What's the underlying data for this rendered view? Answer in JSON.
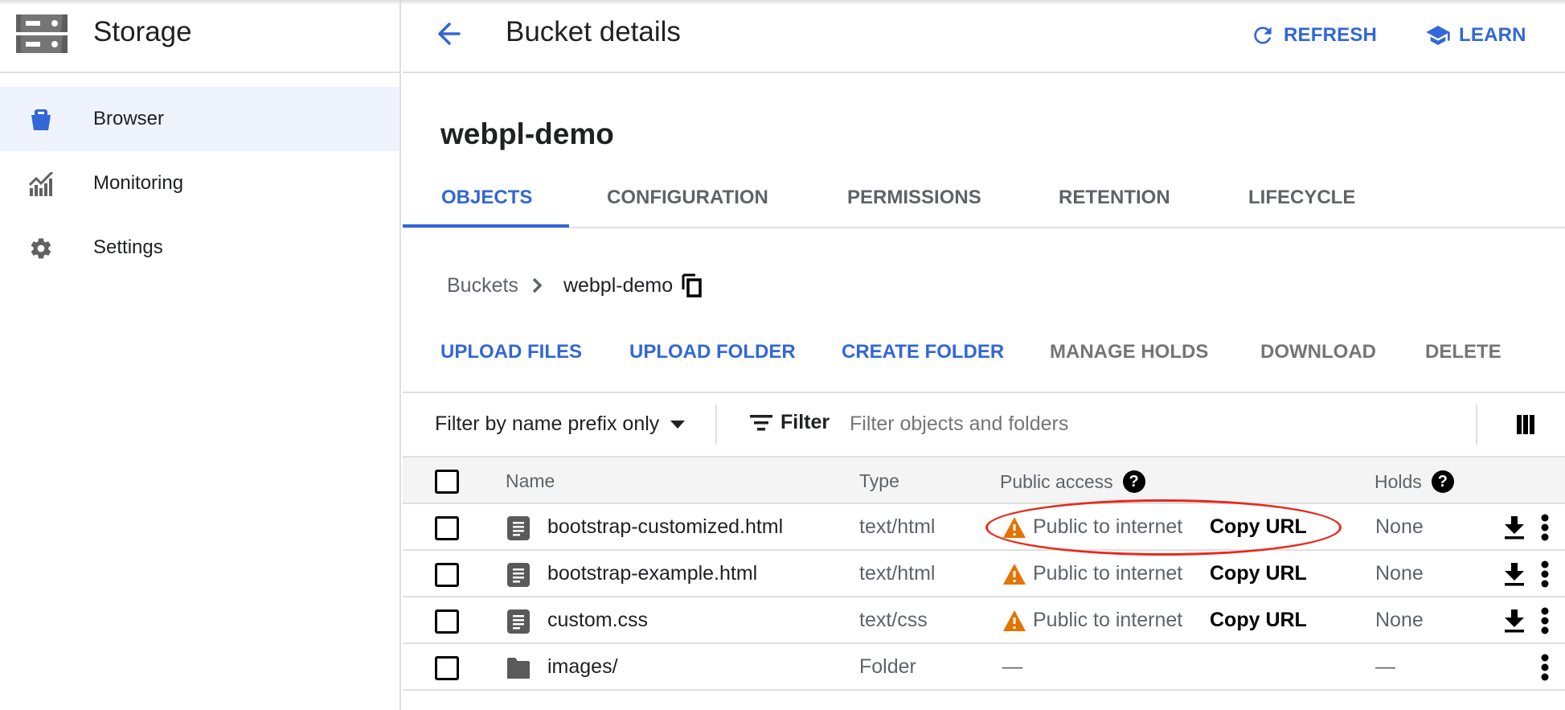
{
  "app": {
    "title": "Storage",
    "logo_icon": "storage-icon"
  },
  "sidebar": {
    "items": [
      {
        "label": "Browser",
        "icon": "bucket-icon",
        "active": true
      },
      {
        "label": "Monitoring",
        "icon": "monitoring-chart-icon",
        "active": false
      },
      {
        "label": "Settings",
        "icon": "gear-icon",
        "active": false
      }
    ]
  },
  "header": {
    "back_icon": "arrow-back-icon",
    "title": "Bucket details",
    "refresh_label": "REFRESH",
    "learn_label": "LEARN"
  },
  "bucket": {
    "name": "webpl-demo"
  },
  "tabs": [
    {
      "label": "OBJECTS",
      "active": true
    },
    {
      "label": "CONFIGURATION",
      "active": false
    },
    {
      "label": "PERMISSIONS",
      "active": false
    },
    {
      "label": "RETENTION",
      "active": false
    },
    {
      "label": "LIFECYCLE",
      "active": false
    }
  ],
  "breadcrumb": {
    "root": "Buckets",
    "current": "webpl-demo"
  },
  "actions": {
    "upload_files": "UPLOAD FILES",
    "upload_folder": "UPLOAD FOLDER",
    "create_folder": "CREATE FOLDER",
    "manage_holds": "MANAGE HOLDS",
    "download": "DOWNLOAD",
    "delete": "DELETE"
  },
  "filter": {
    "mode_label": "Filter by name prefix only",
    "button_label": "Filter",
    "placeholder": "Filter objects and folders",
    "value": ""
  },
  "table": {
    "columns": {
      "name": "Name",
      "type": "Type",
      "public_access": "Public access",
      "holds": "Holds",
      "help": "?"
    },
    "rows": [
      {
        "name": "bootstrap-customized.html",
        "icon": "file-icon",
        "type": "text/html",
        "public_access": "Public to internet",
        "copy_url": "Copy URL",
        "holds": "None",
        "downloadable": true
      },
      {
        "name": "bootstrap-example.html",
        "icon": "file-icon",
        "type": "text/html",
        "public_access": "Public to internet",
        "copy_url": "Copy URL",
        "holds": "None",
        "downloadable": true
      },
      {
        "name": "custom.css",
        "icon": "file-icon",
        "type": "text/css",
        "public_access": "Public to internet",
        "copy_url": "Copy URL",
        "holds": "None",
        "downloadable": true
      },
      {
        "name": "images/",
        "icon": "folder-icon",
        "type": "Folder",
        "public_access": "—",
        "copy_url": "",
        "holds": "—",
        "downloadable": false
      }
    ]
  },
  "colors": {
    "accent": "#3367d6",
    "warning": "#e37400",
    "annotation": "#e8291c",
    "active_bg": "#eef3fd"
  }
}
